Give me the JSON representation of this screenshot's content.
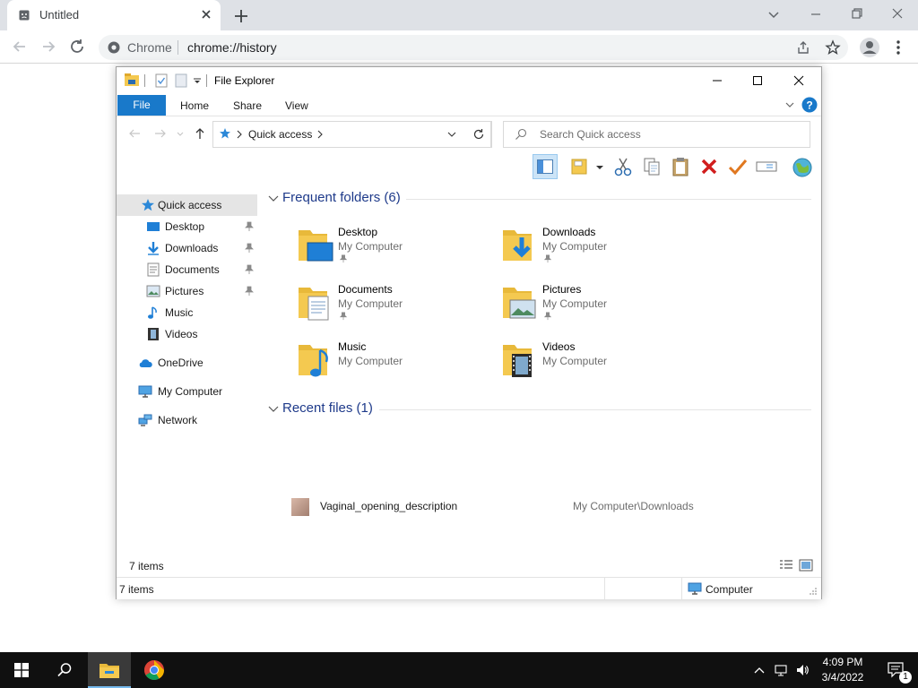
{
  "chrome": {
    "tab_title": "Untitled",
    "site_chip": "Chrome",
    "url": "chrome://history"
  },
  "explorer": {
    "window_title": "File Explorer",
    "ribbon_tabs": [
      "File",
      "Home",
      "Share",
      "View"
    ],
    "address_location": "Quick access",
    "search_placeholder": "Search Quick access",
    "nav": [
      {
        "label": "Quick access",
        "icon": "star-icon",
        "pinned": false
      },
      {
        "label": "Desktop",
        "icon": "desktop-icon",
        "pinned": true
      },
      {
        "label": "Downloads",
        "icon": "download-icon",
        "pinned": true
      },
      {
        "label": "Documents",
        "icon": "documents-icon",
        "pinned": true
      },
      {
        "label": "Pictures",
        "icon": "pictures-icon",
        "pinned": true
      },
      {
        "label": "Music",
        "icon": "music-icon",
        "pinned": false
      },
      {
        "label": "Videos",
        "icon": "videos-icon",
        "pinned": false
      },
      {
        "label": "OneDrive",
        "icon": "cloud-icon",
        "pinned": false
      },
      {
        "label": "My Computer",
        "icon": "computer-icon",
        "pinned": false
      },
      {
        "label": "Network",
        "icon": "network-icon",
        "pinned": false
      }
    ],
    "frequent_header": "Frequent folders (6)",
    "folders": [
      {
        "name": "Desktop",
        "location": "My Computer",
        "pinned": true
      },
      {
        "name": "Downloads",
        "location": "My Computer",
        "pinned": true
      },
      {
        "name": "Documents",
        "location": "My Computer",
        "pinned": true
      },
      {
        "name": "Pictures",
        "location": "My Computer",
        "pinned": true
      },
      {
        "name": "Music",
        "location": "My Computer",
        "pinned": false
      },
      {
        "name": "Videos",
        "location": "My Computer",
        "pinned": false
      }
    ],
    "recent_header": "Recent files (1)",
    "recent_files": [
      {
        "name": "Vaginal_opening_description",
        "path": "My Computer\\Downloads"
      }
    ],
    "items_count": "7 items",
    "status_items": "7 items",
    "status_location": "Computer"
  },
  "taskbar": {
    "time": "4:09 PM",
    "date": "3/4/2022",
    "notification_count": "1"
  },
  "colors": {
    "accent": "#1979ca",
    "folder": "#f4c950",
    "taskbar": "#101010"
  }
}
